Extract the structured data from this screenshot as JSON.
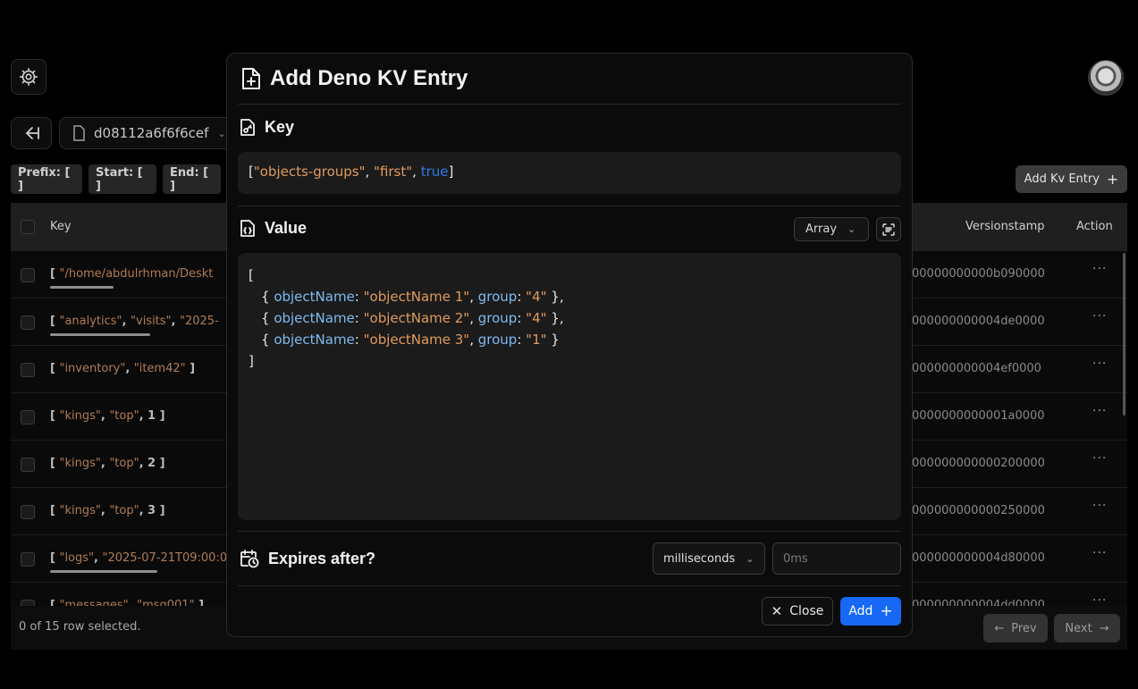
{
  "app": {
    "database_name": "d08112a6f6f6cef",
    "filters": {
      "prefix": "Prefix: [ ]",
      "start": "Start: [ ]",
      "end": "End: [ ]"
    },
    "add_entry_label": "Add Kv Entry",
    "table": {
      "columns": {
        "key": "Key",
        "versionstamp": "Versionstamp",
        "action": "Action"
      },
      "rows": [
        {
          "key_parts": [
            "\"/home/abdulrhman/Deskt"
          ],
          "versionstamp": "00000000000b090000",
          "bar_fraction": 0.47
        },
        {
          "key_parts": [
            "\"analytics\"",
            "\"visits\"",
            "\"2025-"
          ],
          "versionstamp": "000000000004de0000",
          "bar_fraction": 0.74
        },
        {
          "key_parts": [
            "\"inventory\"",
            "\"item42\""
          ],
          "versionstamp": "000000000004ef0000",
          "bar_fraction": 0
        },
        {
          "key_parts": [
            "\"kings\"",
            "\"top\"",
            "1"
          ],
          "versionstamp": "0000000000001a0000",
          "bar_fraction": 0
        },
        {
          "key_parts": [
            "\"kings\"",
            "\"top\"",
            "2"
          ],
          "versionstamp": "000000000000200000",
          "bar_fraction": 0
        },
        {
          "key_parts": [
            "\"kings\"",
            "\"top\"",
            "3"
          ],
          "versionstamp": "000000000000250000",
          "bar_fraction": 0
        },
        {
          "key_parts": [
            "\"logs\"",
            "\"2025-07-21T09:00:0"
          ],
          "versionstamp": "000000000004d80000",
          "bar_fraction": 0.79
        },
        {
          "key_parts": [
            "\"messages\"",
            "\"msg001\""
          ],
          "versionstamp": "000000000004dd0000",
          "bar_fraction": 0
        }
      ],
      "selection_status": "0 of 15 row selected."
    },
    "pagination": {
      "prev_label": "Prev",
      "next_label": "Next"
    }
  },
  "modal": {
    "title": "Add Deno KV Entry",
    "key_section": {
      "title": "Key",
      "tokens": [
        {
          "t": "[",
          "c": "p"
        },
        {
          "t": "\"objects-groups\"",
          "c": "s"
        },
        {
          "t": ", ",
          "c": "p"
        },
        {
          "t": "\"first\"",
          "c": "s"
        },
        {
          "t": ", ",
          "c": "p"
        },
        {
          "t": "true",
          "c": "b"
        },
        {
          "t": "]",
          "c": "p"
        }
      ]
    },
    "value_section": {
      "title": "Value",
      "type_selected": "Array",
      "lines": [
        {
          "indent": 0,
          "tokens": [
            {
              "t": "[",
              "c": "p"
            }
          ]
        },
        {
          "indent": 1,
          "tokens": [
            {
              "t": "{ ",
              "c": "p"
            },
            {
              "t": "objectName",
              "c": "k"
            },
            {
              "t": ": ",
              "c": "p"
            },
            {
              "t": "\"objectName 1\"",
              "c": "s"
            },
            {
              "t": ", ",
              "c": "p"
            },
            {
              "t": "group",
              "c": "k"
            },
            {
              "t": ": ",
              "c": "p"
            },
            {
              "t": "\"4\"",
              "c": "s"
            },
            {
              "t": " },",
              "c": "p"
            }
          ]
        },
        {
          "indent": 1,
          "tokens": [
            {
              "t": "{ ",
              "c": "p"
            },
            {
              "t": "objectName",
              "c": "k"
            },
            {
              "t": ": ",
              "c": "p"
            },
            {
              "t": "\"objectName 2\"",
              "c": "s"
            },
            {
              "t": ", ",
              "c": "p"
            },
            {
              "t": "group",
              "c": "k"
            },
            {
              "t": ": ",
              "c": "p"
            },
            {
              "t": "\"4\"",
              "c": "s"
            },
            {
              "t": " },",
              "c": "p"
            }
          ]
        },
        {
          "indent": 1,
          "tokens": [
            {
              "t": "{ ",
              "c": "p"
            },
            {
              "t": "objectName",
              "c": "k"
            },
            {
              "t": ": ",
              "c": "p"
            },
            {
              "t": "\"objectName 3\"",
              "c": "s"
            },
            {
              "t": ", ",
              "c": "p"
            },
            {
              "t": "group",
              "c": "k"
            },
            {
              "t": ": ",
              "c": "p"
            },
            {
              "t": "\"1\"",
              "c": "s"
            },
            {
              "t": " }",
              "c": "p"
            }
          ]
        },
        {
          "indent": 0,
          "tokens": [
            {
              "t": "]",
              "c": "p"
            }
          ]
        }
      ]
    },
    "expires_section": {
      "title": "Expires after?",
      "unit_selected": "milliseconds",
      "input_value": "",
      "input_placeholder": "0ms"
    },
    "close_label": "Close",
    "add_label": "Add"
  },
  "colors": {
    "accent": "#1668f5",
    "string": "#e09a5c",
    "object_key": "#7dbbf2",
    "boolean": "#2b7de9",
    "table_string": "#b07c55"
  },
  "icons": [
    "gear-icon",
    "back-arrow-icon",
    "file-icon",
    "chevron-down-icon",
    "plus-icon",
    "file-plus-icon",
    "file-key-icon",
    "file-braces-icon",
    "scan-text-icon",
    "calendar-clock-icon",
    "close-icon",
    "arrow-left-icon",
    "arrow-right-icon",
    "more-horizontal-icon"
  ]
}
